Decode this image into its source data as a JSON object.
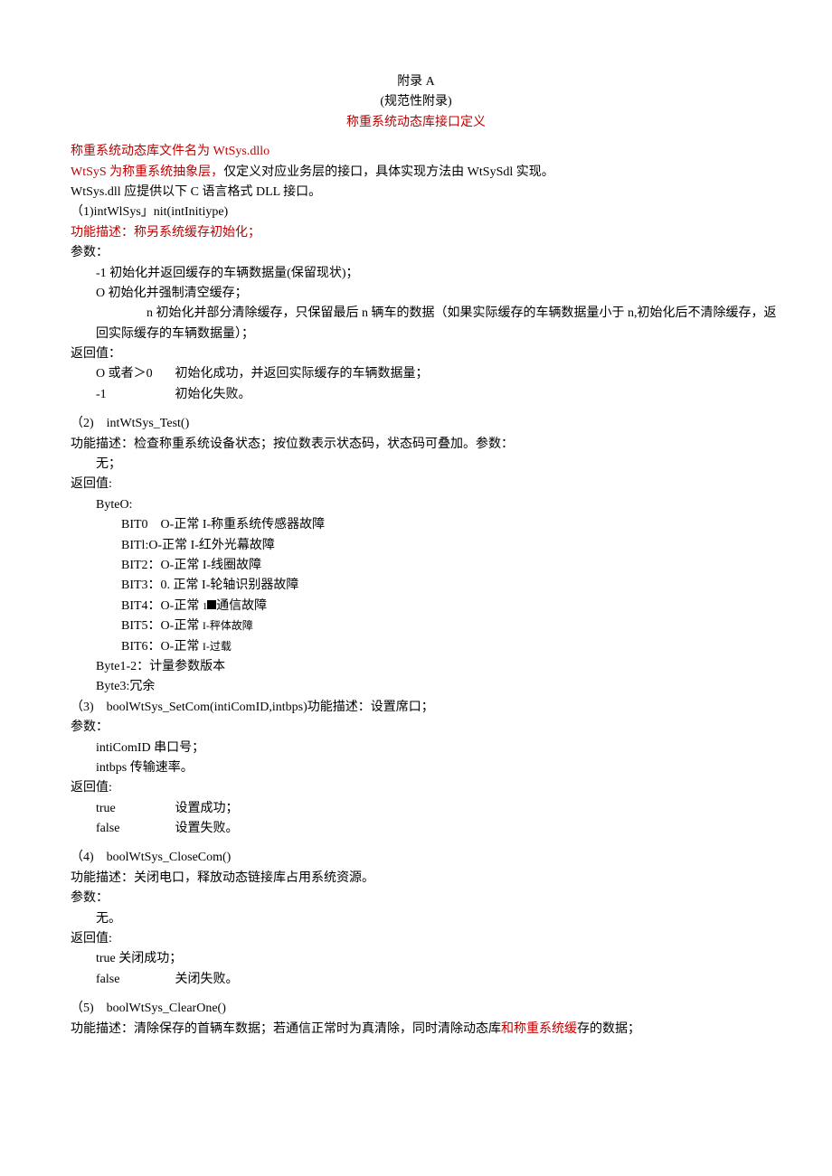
{
  "header": {
    "title1": "附录 A",
    "title2": "(规范性附录)",
    "title3": "称重系统动态库接口定义"
  },
  "intro": {
    "l1a": "称重系统动态库文件名为 WtSys.dllo",
    "l2a": "WtSyS 为称重系统抽象层，",
    "l2b": "仅定义对应业务层的接口，具体实现方法由 WtSySdl 实现。",
    "l3": "WtSys.dll 应提供以下 C 语言格式 DLL 接口。"
  },
  "f1": {
    "sig": "（1)intWlSys」nit(intInitiype)",
    "desc": "功能描述：称另系统缓存初始化；",
    "param_label": "参数：",
    "p1": "-1 初始化并返回缓存的车辆数据量(保留现状)；",
    "p2": "O 初始化并强制清空缓存；",
    "p3": "n 初始化并部分清除缓存，只保留最后 n 辆车的数据（如果实际缓存的车辆数据量小于 n,初始化后不清除缓存，返回实际缓存的车辆数据量）；",
    "ret_label": "返回值：",
    "r1a": "O 或者＞0",
    "r1b": "初始化成功，并返回实际缓存的车辆数据量；",
    "r2a": "-1",
    "r2b": "初始化失败。"
  },
  "f2": {
    "sig": "（2) intWtSys_Test()",
    "desc": "功能描述：检查称重系统设备状态；按位数表示状态码，状态码可叠加。参数：",
    "p_none": "无；",
    "ret_label": "返回值:",
    "byte0": "ByteO:",
    "b0": "BIT0 O-正常 I-称重系统传感器故障",
    "b1": "BITl:O-正常 I-红外光幕故障",
    "b2": "BIT2：O-正常 I-线圈故障",
    "b3": "BIT3：0. 正常 I-轮轴识别器故障",
    "b4a": "BIT4：O-正常 ",
    "b4b": "通信故障",
    "b5a": "BIT5：O-正常 ",
    "b5b": "I-秤体故障",
    "b6a": "BIT6：O-正常 ",
    "b6b": "I-过载",
    "byte12": "Byte1-2：计量参数版本",
    "byte3": "Byte3:冗余"
  },
  "f3": {
    "sig": "（3) boolWtSys_SetCom(intiComID,intbps)功能描述：设置席口；",
    "param_label": "参数：",
    "p1": "intiComID 串口号；",
    "p2": "intbps 传输速率。",
    "ret_label": "返回值:",
    "r1a": "true",
    "r1b": "设置成功；",
    "r2a": "false",
    "r2b": "设置失败。"
  },
  "f4": {
    "sig": "（4) boolWtSys_CloseCom()",
    "desc": "功能描述：关闭电口，释放动态链接库占用系统资源。",
    "param_label": "参数：",
    "p_none": "无。",
    "ret_label": "返回值:",
    "r1": "true 关闭成功；",
    "r2a": "false",
    "r2b": "关闭失败。"
  },
  "f5": {
    "sig": "（5) boolWtSys_ClearOne()",
    "desc_a": "功能描述：清除保存的首辆车数据；若通信正常时为真清除，同时清除动态库",
    "desc_b": "和称重系统缓",
    "desc_c": "存的数据；"
  }
}
